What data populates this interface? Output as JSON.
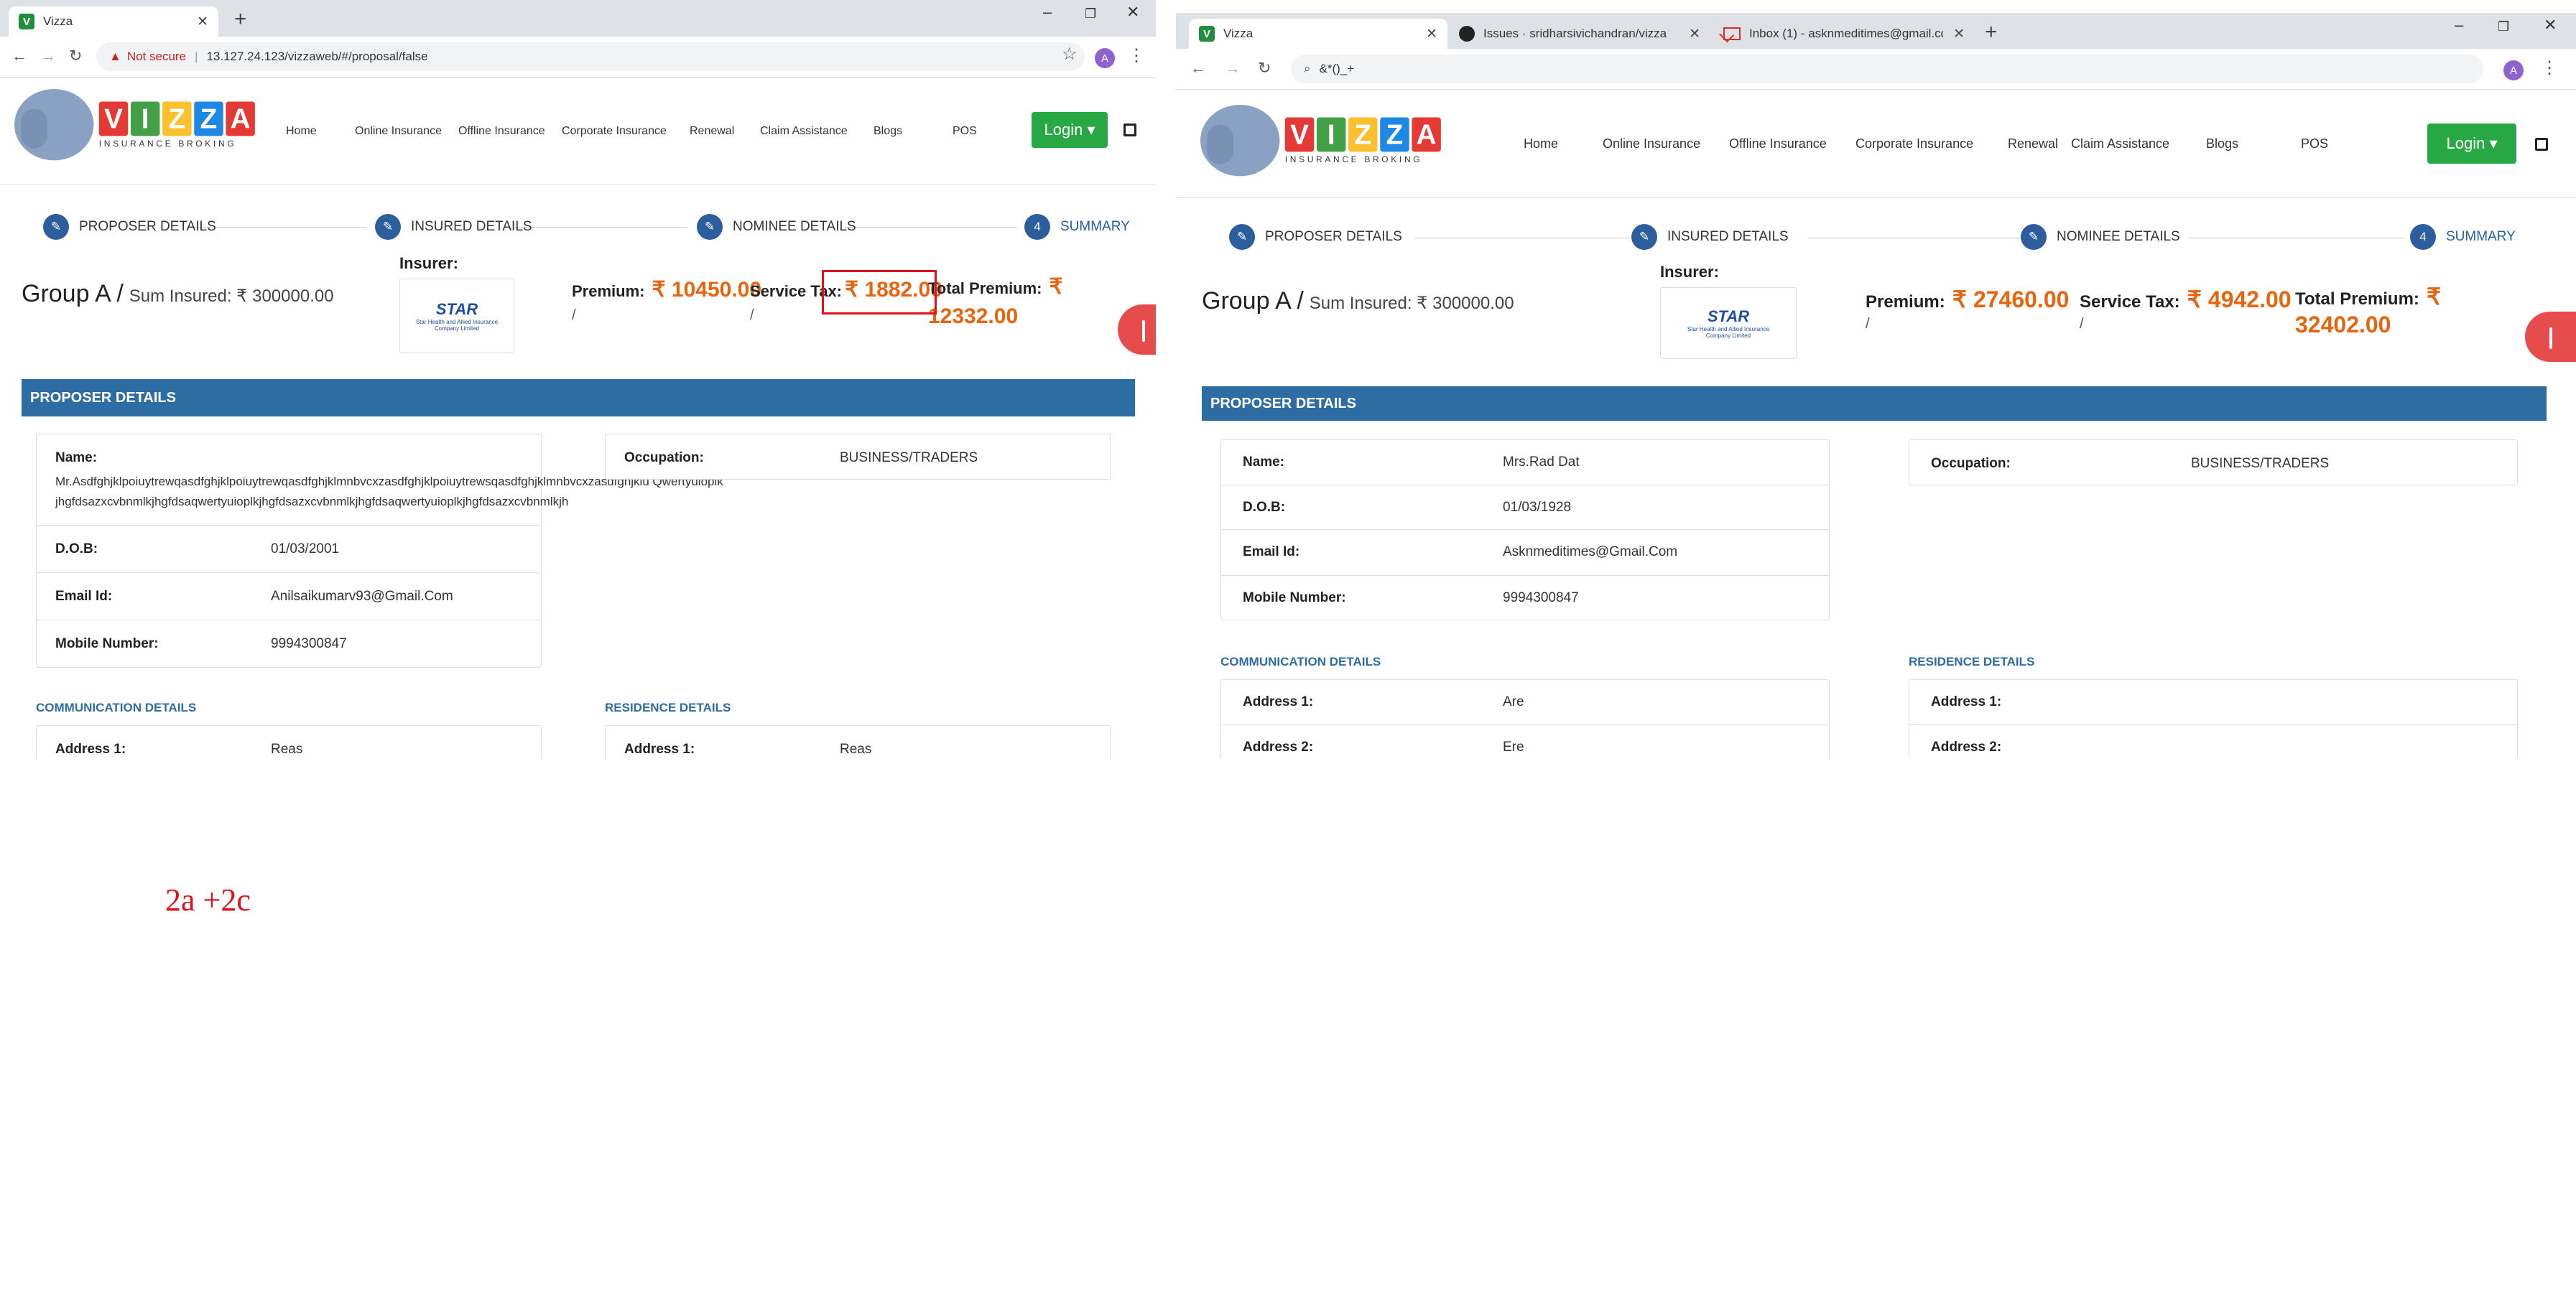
{
  "left": {
    "tab_title": "Vizza",
    "url": "13.127.24.123/vizzaweb/#/proposal/false",
    "not_secure": "Not secure",
    "avatar": "A",
    "logo_text": [
      "V",
      "I",
      "Z",
      "Z",
      "A"
    ],
    "logo_sub": "INSURANCE BROKING",
    "menu": [
      "Home",
      "Online Insurance",
      "Offline Insurance",
      "Corporate Insurance",
      "Renewal",
      "Claim Assistance",
      "Blogs",
      "POS"
    ],
    "login": "Login",
    "steps": [
      {
        "n": "",
        "label": "PROPOSER DETAILS"
      },
      {
        "n": "",
        "label": "INSURED DETAILS"
      },
      {
        "n": "",
        "label": "NOMINEE DETAILS"
      },
      {
        "n": "4",
        "label": "SUMMARY"
      }
    ],
    "group": "Group A /",
    "sum_insured": "Sum Insured: ₹ 300000.00",
    "insurer_label": "Insurer:",
    "insurer_logo": "STAR",
    "insurer_logo_sub": "Star Health and Allied Insurance Company Limited",
    "premium_label": "Premium:",
    "premium_value": "₹ 10450.00",
    "tax_label": "Service Tax:",
    "tax_value": "₹ 1882.00",
    "total_label": "Total Premium:",
    "total_value_a": "₹",
    "total_value_b": "12332.00",
    "slash": "/",
    "section": "PROPOSER DETAILS",
    "name_label": "Name:",
    "name_value": "Mr.Asdfghjklpoiuytrewqasdfghjklpoiuytrewqasdfghjklmnbvcxzasdfghjklpoiuytrewsqasdfghjklmnbvcxzasdfghjklu Qwertyuioplkjhgfdsazxcvbnmlkjhgfdsaqwertyuioplkjhgfdsazxcvbnmlkjhgfdsaqwertyuioplkjhgfdsazxcvbnmlkjh",
    "dob_label": "D.O.B:",
    "dob_value": "01/03/2001",
    "email_label": "Email Id:",
    "email_value": "Anilsaikumarv93@Gmail.Com",
    "mobile_label": "Mobile Number:",
    "mobile_value": "9994300847",
    "occ_label": "Occupation:",
    "occ_value": "BUSINESS/TRADERS",
    "comm": "COMMUNICATION DETAILS",
    "res": "RESIDENCE DETAILS",
    "addr1_label": "Address 1:",
    "addr1_comm": "Reas",
    "addr1_res": "Reas"
  },
  "right": {
    "tabs": [
      "Vizza",
      "Issues · sridharsivichandran/vizza",
      "Inbox (1) - asknmeditimes@gmail.com"
    ],
    "url": "&*()_+",
    "avatar": "A",
    "logo_text": [
      "V",
      "I",
      "Z",
      "Z",
      "A"
    ],
    "logo_sub": "INSURANCE BROKING",
    "menu": [
      "Home",
      "Online Insurance",
      "Offline Insurance",
      "Corporate Insurance",
      "Renewal",
      "Claim Assistance",
      "Blogs",
      "POS"
    ],
    "login": "Login",
    "steps": [
      {
        "n": "",
        "label": "PROPOSER DETAILS"
      },
      {
        "n": "",
        "label": "INSURED DETAILS"
      },
      {
        "n": "",
        "label": "NOMINEE DETAILS"
      },
      {
        "n": "4",
        "label": "SUMMARY"
      }
    ],
    "group": "Group A /",
    "sum_insured": "Sum Insured: ₹ 300000.00",
    "insurer_label": "Insurer:",
    "insurer_logo": "STAR",
    "insurer_logo_sub": "Star Health and Allied Insurance Company Limited",
    "premium_label": "Premium:",
    "premium_value": "₹ 27460.00",
    "tax_label": "Service Tax:",
    "tax_value": "₹ 4942.00",
    "total_label": "Total Premium:",
    "total_value_a": "₹",
    "total_value_b": "32402.00",
    "slash": "/",
    "section": "PROPOSER DETAILS",
    "name_label": "Name:",
    "name_value": "Mrs.Rad Dat",
    "dob_label": "D.O.B:",
    "dob_value": "01/03/1928",
    "email_label": "Email Id:",
    "email_value": "Asknmeditimes@Gmail.Com",
    "mobile_label": "Mobile Number:",
    "mobile_value": "9994300847",
    "occ_label": "Occupation:",
    "occ_value": "BUSINESS/TRADERS",
    "comm": "COMMUNICATION DETAILS",
    "res": "RESIDENCE DETAILS",
    "addr1_label": "Address 1:",
    "addr1_value": "Are",
    "addr2_label": "Address 2:",
    "addr2_value": "Ere",
    "res_addr1_label": "Address 1:",
    "res_addr2_label": "Address 2:"
  },
  "annotation": "2a +2c",
  "colors": {
    "brand_blue": "#2e6da4",
    "accent_orange": "#e8650e",
    "login_green": "#28a745",
    "highlight_red": "#e0101c"
  }
}
